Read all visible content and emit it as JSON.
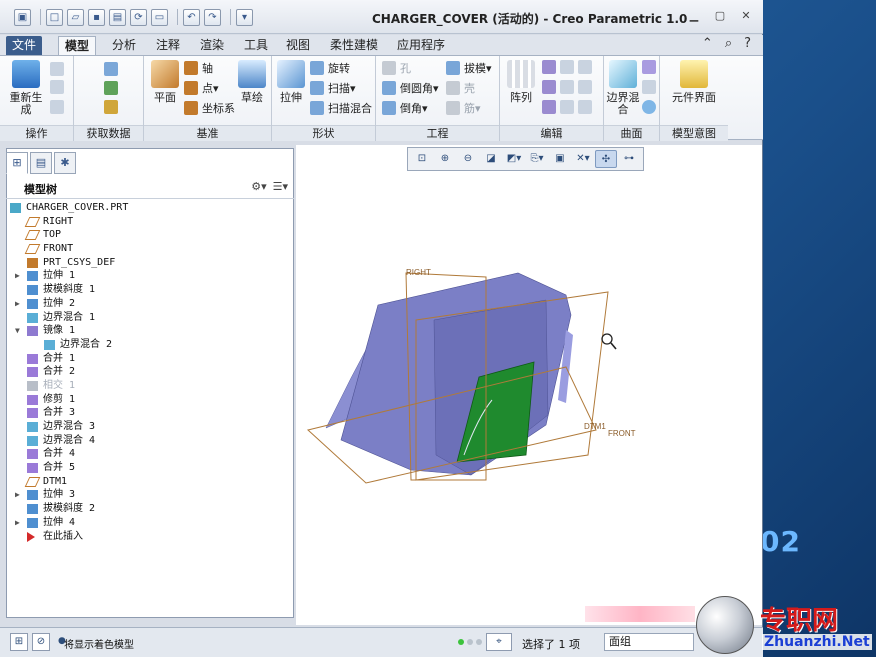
{
  "window": {
    "title": "CHARGER_COVER (活动的) - Creo Parametric 1.0"
  },
  "quick_access": [
    "new-icon",
    "open-icon",
    "save-icon",
    "regenerate-icon",
    "window-icon",
    "undo-icon",
    "redo-icon"
  ],
  "tabs": [
    {
      "label": "文件"
    },
    {
      "label": "模型"
    },
    {
      "label": "分析"
    },
    {
      "label": "注释"
    },
    {
      "label": "渲染"
    },
    {
      "label": "工具"
    },
    {
      "label": "视图"
    },
    {
      "label": "柔性建模"
    },
    {
      "label": "应用程序"
    }
  ],
  "ribbon": {
    "operations": {
      "label": "操作",
      "regenerate": "重新生成"
    },
    "get_data": {
      "label": "获取数据"
    },
    "datum": {
      "label": "基准",
      "plane": "平面",
      "axis": "轴",
      "point": "点",
      "csys": "坐标系",
      "sketch": "草绘"
    },
    "shapes": {
      "label": "形状",
      "extrude": "拉伸",
      "revolve": "旋转",
      "sweep": "扫描",
      "swept_blend": "扫描混合"
    },
    "engineering": {
      "label": "工程",
      "hole": "孔",
      "draft": "拔模",
      "round": "倒圆角",
      "shell": "壳",
      "chamfer": "倒角",
      "rib": "筋"
    },
    "editing": {
      "label": "编辑",
      "pattern": "阵列"
    },
    "surfaces": {
      "label": "曲面",
      "boundary_blend": "边界混合"
    },
    "model_intent": {
      "label": "模型意图",
      "component_interface": "元件界面"
    }
  },
  "model_tree": {
    "title": "模型树",
    "items": [
      {
        "label": "CHARGER_COVER.PRT",
        "icon": "part-icon",
        "level": 0,
        "expander": ""
      },
      {
        "label": "RIGHT",
        "icon": "datum-plane-icon",
        "level": 1,
        "expander": ""
      },
      {
        "label": "TOP",
        "icon": "datum-plane-icon",
        "level": 1,
        "expander": ""
      },
      {
        "label": "FRONT",
        "icon": "datum-plane-icon",
        "level": 1,
        "expander": ""
      },
      {
        "label": "PRT_CSYS_DEF",
        "icon": "csys-icon",
        "level": 1,
        "expander": ""
      },
      {
        "label": "拉伸 1",
        "icon": "extrude-icon",
        "level": 1,
        "expander": "▶"
      },
      {
        "label": "拔模斜度 1",
        "icon": "draft-icon",
        "level": 1,
        "expander": ""
      },
      {
        "label": "拉伸 2",
        "icon": "extrude-icon",
        "level": 1,
        "expander": "▶"
      },
      {
        "label": "边界混合 1",
        "icon": "boundary-blend-icon",
        "level": 1,
        "expander": ""
      },
      {
        "label": "镜像 1",
        "icon": "mirror-icon",
        "level": 1,
        "expander": "▼"
      },
      {
        "label": "边界混合 2",
        "icon": "boundary-blend-icon",
        "level": 2,
        "expander": ""
      },
      {
        "label": "合并 1",
        "icon": "merge-icon",
        "level": 1,
        "expander": ""
      },
      {
        "label": "合并 2",
        "icon": "merge-icon",
        "level": 1,
        "expander": ""
      },
      {
        "label": "相交 1",
        "icon": "intersect-icon",
        "level": 1,
        "expander": "",
        "disabled": true
      },
      {
        "label": "修剪 1",
        "icon": "trim-icon",
        "level": 1,
        "expander": ""
      },
      {
        "label": "合并 3",
        "icon": "merge-icon",
        "level": 1,
        "expander": ""
      },
      {
        "label": "边界混合 3",
        "icon": "boundary-blend-icon",
        "level": 1,
        "expander": ""
      },
      {
        "label": "边界混合 4",
        "icon": "boundary-blend-icon",
        "level": 1,
        "expander": ""
      },
      {
        "label": "合并 4",
        "icon": "merge-icon",
        "level": 1,
        "expander": ""
      },
      {
        "label": "合并 5",
        "icon": "merge-icon",
        "level": 1,
        "expander": ""
      },
      {
        "label": "DTM1",
        "icon": "datum-plane-icon",
        "level": 1,
        "expander": ""
      },
      {
        "label": "拉伸 3",
        "icon": "extrude-icon",
        "level": 1,
        "expander": "▶"
      },
      {
        "label": "拔模斜度 2",
        "icon": "draft-icon",
        "level": 1,
        "expander": ""
      },
      {
        "label": "拉伸 4",
        "icon": "extrude-icon",
        "level": 1,
        "expander": "▶"
      },
      {
        "label": "在此插入",
        "icon": "insert-here-icon",
        "level": 1,
        "expander": ""
      }
    ]
  },
  "viewport": {
    "datum_labels": {
      "right": "RIGHT",
      "front": "FRONT",
      "dtm1": "DTM1"
    },
    "colors": {
      "body": "#7b7fc6",
      "selected_face": "#1f8a2e",
      "datum": "#b07a3a"
    }
  },
  "statusbar": {
    "message": "将显示着色模型",
    "selection": "选择了 1 项",
    "filter": "面组"
  },
  "watermark": {
    "title": "专职网",
    "url": "Zhuanzhi.Net",
    "desktop_text": "02"
  },
  "colors": {
    "accent": "#3b5d8c",
    "ribbon_bg": "#eef1f6"
  }
}
